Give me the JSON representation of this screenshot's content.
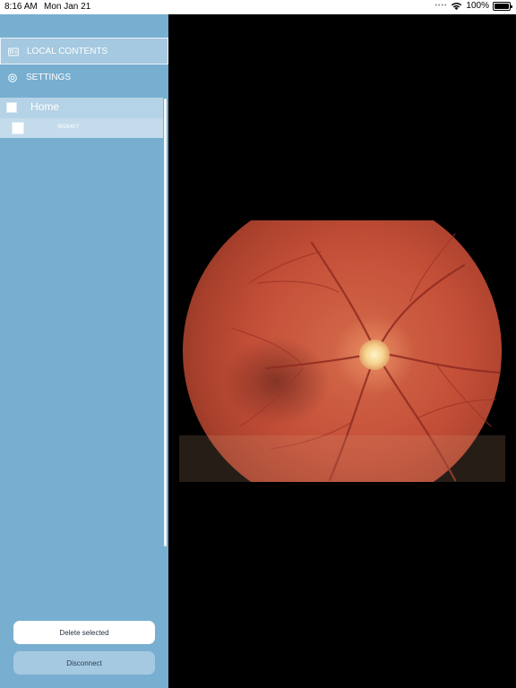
{
  "status_bar": {
    "time": "8:16 AM",
    "date": "Mon Jan 21",
    "battery": "100%"
  },
  "sidebar": {
    "nav": [
      {
        "label": "LOCAL CONTENTS",
        "icon": "image-folder-icon",
        "active": true
      },
      {
        "label": "SETTINGS",
        "icon": "gear-icon",
        "active": false
      }
    ],
    "tree": {
      "root_label": "Home",
      "items": [
        {
          "label": "IM264EY"
        }
      ]
    },
    "buttons": {
      "delete_label": "Delete selected",
      "disconnect_label": "Disconnect"
    }
  },
  "viewer": {
    "content": "retinal fundus photograph"
  },
  "colors": {
    "sidebar_bg": "#78aed0",
    "active_nav_bg": "#a5c9e0",
    "tree_bg": "#b5d3e6",
    "viewer_bg": "#000000"
  }
}
